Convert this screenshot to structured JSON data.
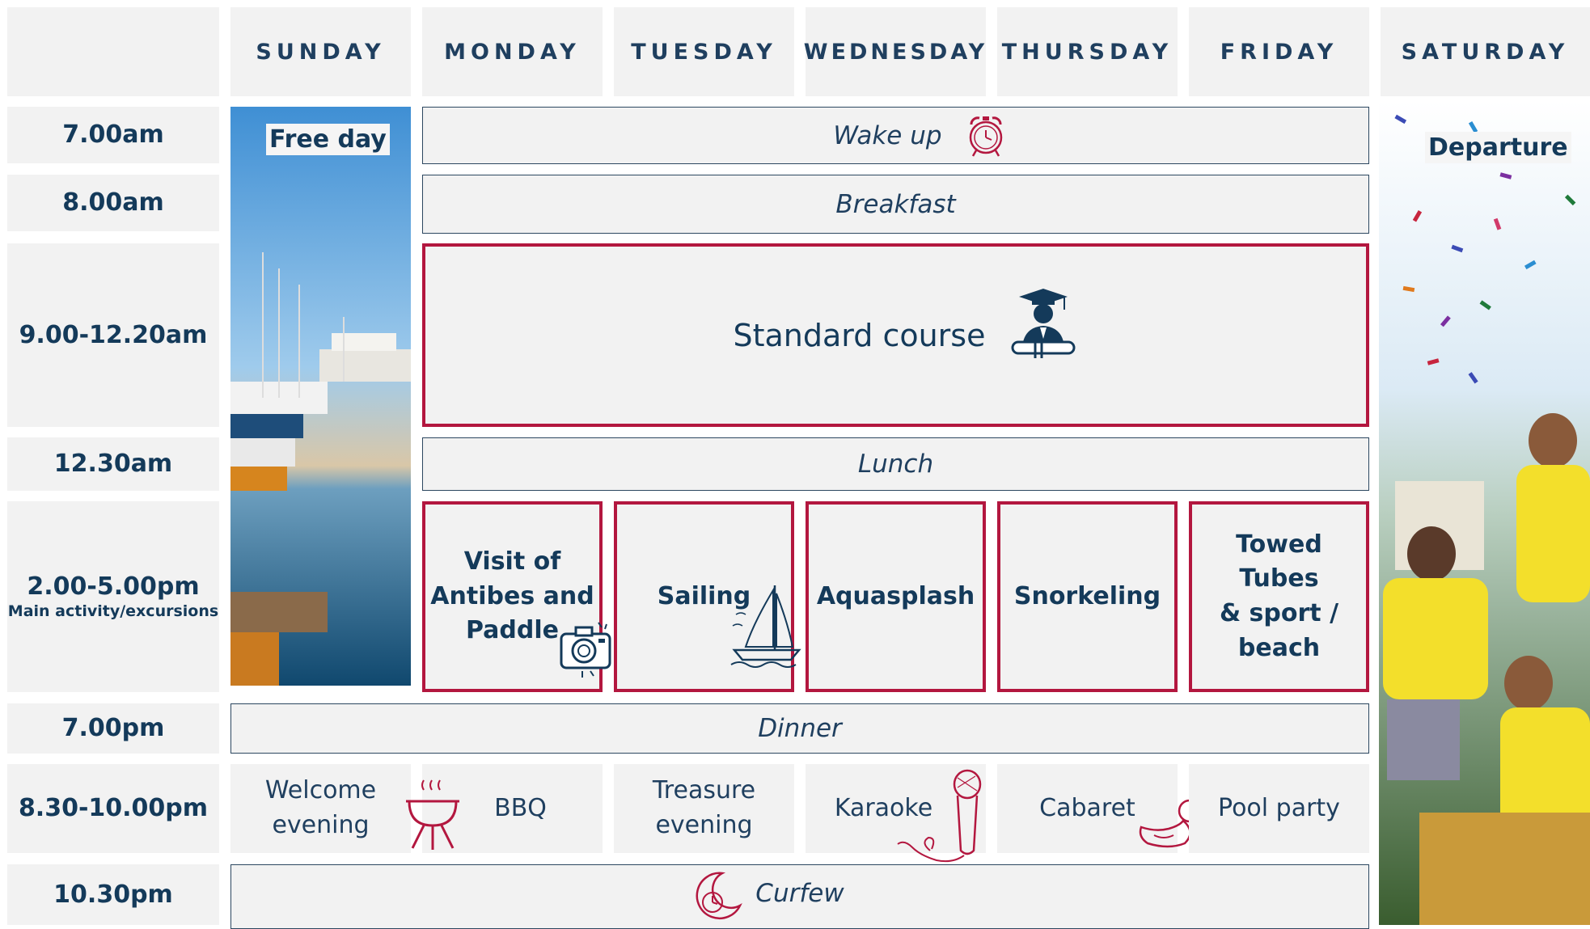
{
  "days": [
    "SUNDAY",
    "MONDAY",
    "TUESDAY",
    "WEDNESDAY",
    "THURSDAY",
    "FRIDAY",
    "SATURDAY"
  ],
  "times": {
    "t1": "7.00am",
    "t2": "8.00am",
    "t3": "9.00-12.20am",
    "t4": "12.30am",
    "t5": "2.00-5.00pm",
    "t5_sub": "Main activity/excursions",
    "t6": "7.00pm",
    "t7": "8.30-10.00pm",
    "t8": "10.30pm"
  },
  "sunday_label": "Free day",
  "saturday_label": "Departure",
  "daily": {
    "wake_up": "Wake up",
    "breakfast": "Breakfast",
    "course": "Standard course",
    "lunch": "Lunch",
    "dinner": "Dinner",
    "curfew": "Curfew"
  },
  "activities": {
    "monday": [
      "Visit of",
      "Antibes and",
      "Paddle"
    ],
    "tuesday": "Sailing",
    "wednesday": "Aquasplash",
    "thursday": "Snorkeling",
    "friday": [
      "Towed Tubes",
      "& sport /",
      "beach"
    ]
  },
  "evenings": {
    "sunday": [
      "Welcome",
      "evening"
    ],
    "monday": "BBQ",
    "tuesday": [
      "Treasure",
      "evening"
    ],
    "wednesday": "Karaoke",
    "thursday": "Cabaret",
    "friday": "Pool party"
  },
  "colors": {
    "navy": "#143a5a",
    "accent_red": "#b3173f",
    "cell_bg": "#f2f2f2",
    "confetti_yellow": "#f3df2b"
  },
  "icons": [
    "alarm-clock-icon",
    "graduate-icon",
    "camera-icon",
    "sailboat-icon",
    "bbq-grill-icon",
    "microphone-icon",
    "rubber-duck-icon",
    "moon-clock-icon"
  ]
}
